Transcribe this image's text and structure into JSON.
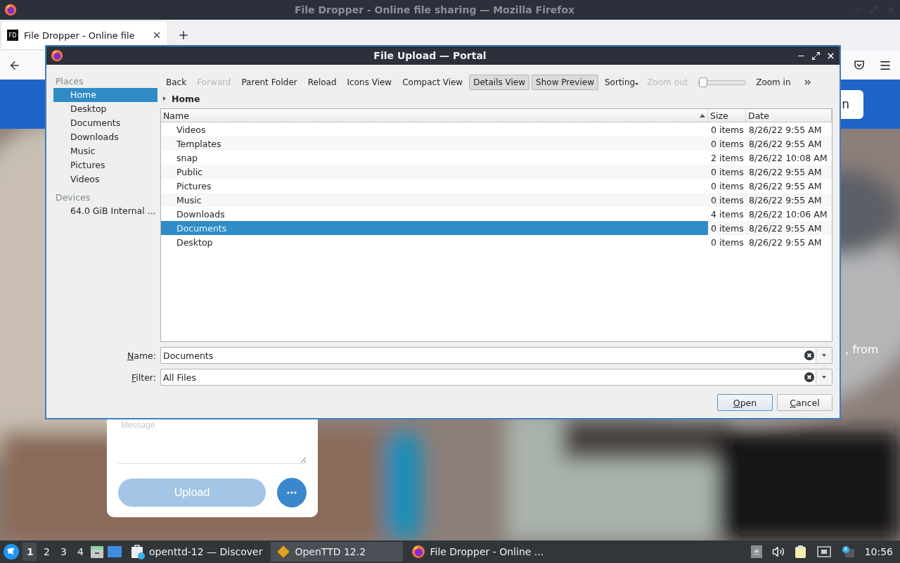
{
  "browser": {
    "title": "File Dropper - Online file sharing — Mozilla Firefox",
    "tab": {
      "favicon_text": "FD",
      "label": "File Dropper - Online file"
    }
  },
  "page": {
    "header_button": "n",
    "side_text": ", from",
    "message_placeholder": "Message",
    "upload_button": "Upload",
    "upload_disabled": true
  },
  "dialog": {
    "title": "File Upload — Portal",
    "places_heading": "Places",
    "places": [
      {
        "label": "Home",
        "selected": true
      },
      {
        "label": "Desktop",
        "selected": false
      },
      {
        "label": "Documents",
        "selected": false
      },
      {
        "label": "Downloads",
        "selected": false
      },
      {
        "label": "Music",
        "selected": false
      },
      {
        "label": "Pictures",
        "selected": false
      },
      {
        "label": "Videos",
        "selected": false
      }
    ],
    "devices_heading": "Devices",
    "devices": [
      {
        "label": "64.0 GiB Internal ...",
        "selected": false
      }
    ],
    "toolbar": [
      {
        "kind": "button",
        "label": "Back",
        "disabled": false
      },
      {
        "kind": "button",
        "label": "Forward",
        "disabled": true
      },
      {
        "kind": "button",
        "label": "Parent Folder",
        "disabled": false
      },
      {
        "kind": "button",
        "label": "Reload",
        "disabled": false
      },
      {
        "kind": "toggle",
        "label": "Icons View",
        "checked": false
      },
      {
        "kind": "toggle",
        "label": "Compact View",
        "checked": false
      },
      {
        "kind": "toggle",
        "label": "Details View",
        "checked": true
      },
      {
        "kind": "toggle",
        "label": "Show Preview",
        "checked": true
      },
      {
        "kind": "menu",
        "label": "Sorting"
      },
      {
        "kind": "button",
        "label": "Zoom out",
        "disabled": true
      },
      {
        "kind": "slider",
        "level": 0
      },
      {
        "kind": "button",
        "label": "Zoom in",
        "disabled": false
      },
      {
        "kind": "overflow"
      }
    ],
    "breadcrumb": "Home",
    "columns": [
      {
        "label": "Name",
        "sorted": true
      },
      {
        "label": "Size",
        "sorted": false
      },
      {
        "label": "Date",
        "sorted": false
      }
    ],
    "rows": [
      {
        "name": "Videos",
        "size": "0 items",
        "date": "8/26/22 9:55 AM",
        "selected": false
      },
      {
        "name": "Templates",
        "size": "0 items",
        "date": "8/26/22 9:55 AM",
        "selected": false
      },
      {
        "name": "snap",
        "size": "2 items",
        "date": "8/26/22 10:08 AM",
        "selected": false
      },
      {
        "name": "Public",
        "size": "0 items",
        "date": "8/26/22 9:55 AM",
        "selected": false
      },
      {
        "name": "Pictures",
        "size": "0 items",
        "date": "8/26/22 9:55 AM",
        "selected": false
      },
      {
        "name": "Music",
        "size": "0 items",
        "date": "8/26/22 9:55 AM",
        "selected": false
      },
      {
        "name": "Downloads",
        "size": "4 items",
        "date": "8/26/22 10:06 AM",
        "selected": false
      },
      {
        "name": "Documents",
        "size": "0 items",
        "date": "8/26/22 9:55 AM",
        "selected": true
      },
      {
        "name": "Desktop",
        "size": "0 items",
        "date": "8/26/22 9:55 AM",
        "selected": false
      }
    ],
    "fields": [
      {
        "label": "Name:",
        "value": "Documents"
      },
      {
        "label": "Filter:",
        "value": "All Files"
      }
    ],
    "buttons": [
      {
        "label": "Open",
        "default": true
      },
      {
        "label": "Cancel",
        "default": false
      }
    ]
  },
  "taskbar": {
    "workspaces": [
      {
        "label": "1",
        "selected": true
      },
      {
        "label": "2",
        "selected": false
      },
      {
        "label": "3",
        "selected": false
      },
      {
        "label": "4",
        "selected": false
      }
    ],
    "tasks": [
      {
        "kind": "discover",
        "label": "openttd-12 — Discover",
        "selected": false
      },
      {
        "kind": "openttd",
        "label": "OpenTTD 12.2",
        "selected": true
      },
      {
        "kind": "firefox",
        "label": "File Dropper - Online ...",
        "selected": false
      }
    ],
    "clock": "10:56"
  }
}
